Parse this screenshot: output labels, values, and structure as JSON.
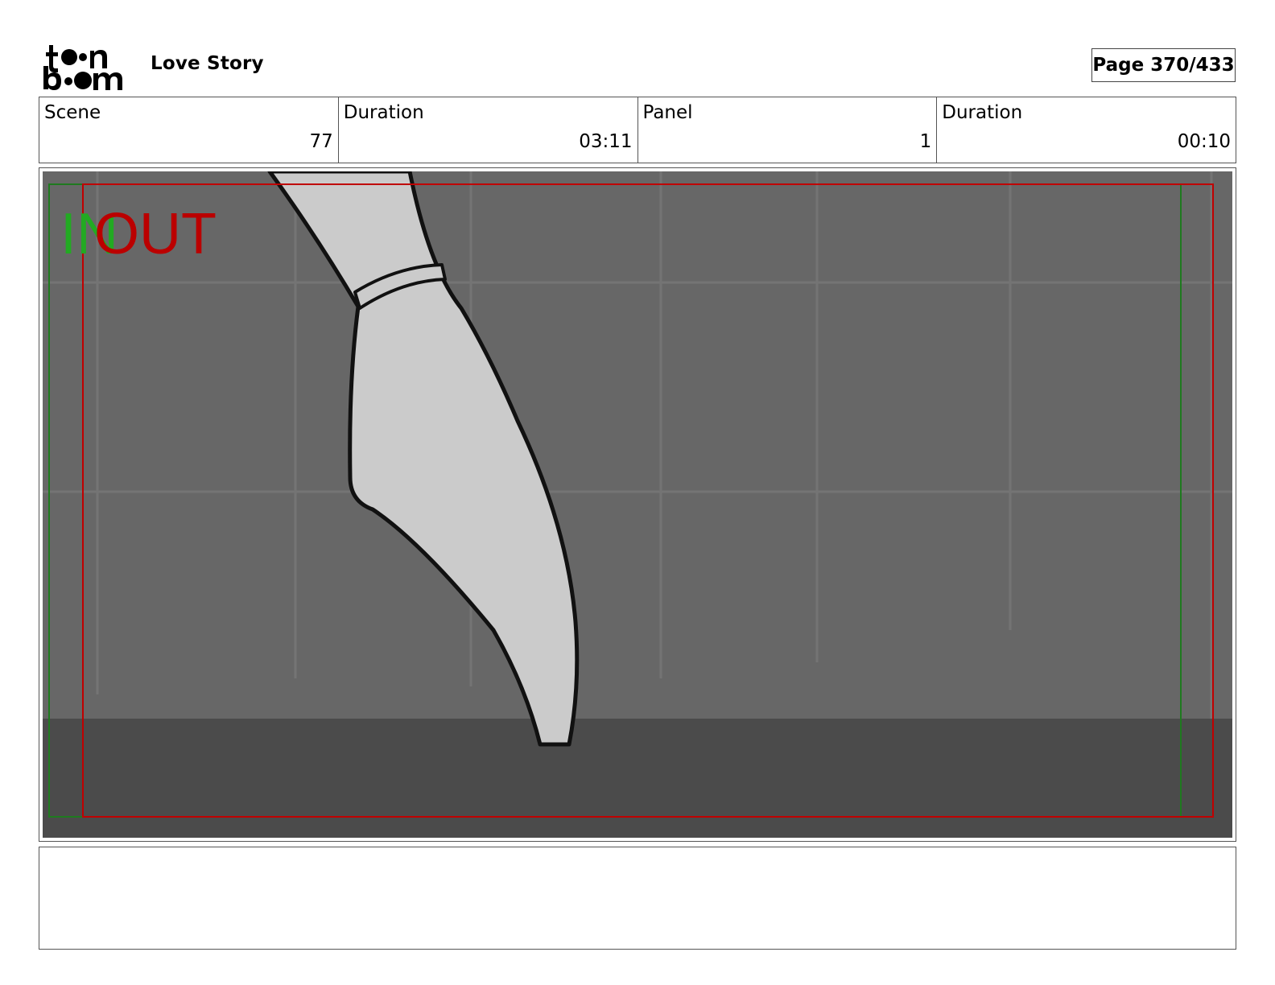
{
  "header": {
    "logo_text": "toon boom",
    "project_title": "Love Story",
    "page_label": "Page 370/433"
  },
  "info": {
    "scene_label": "Scene",
    "scene_value": "77",
    "scene_duration_label": "Duration",
    "scene_duration_value": "03:11",
    "panel_label": "Panel",
    "panel_value": "1",
    "panel_duration_label": "Duration",
    "panel_duration_value": "00:10"
  },
  "panel": {
    "in_label": "IN",
    "out_label": "OUT",
    "in_color": "#22aa22",
    "out_color": "#bb0000"
  },
  "notes": {
    "text": ""
  }
}
